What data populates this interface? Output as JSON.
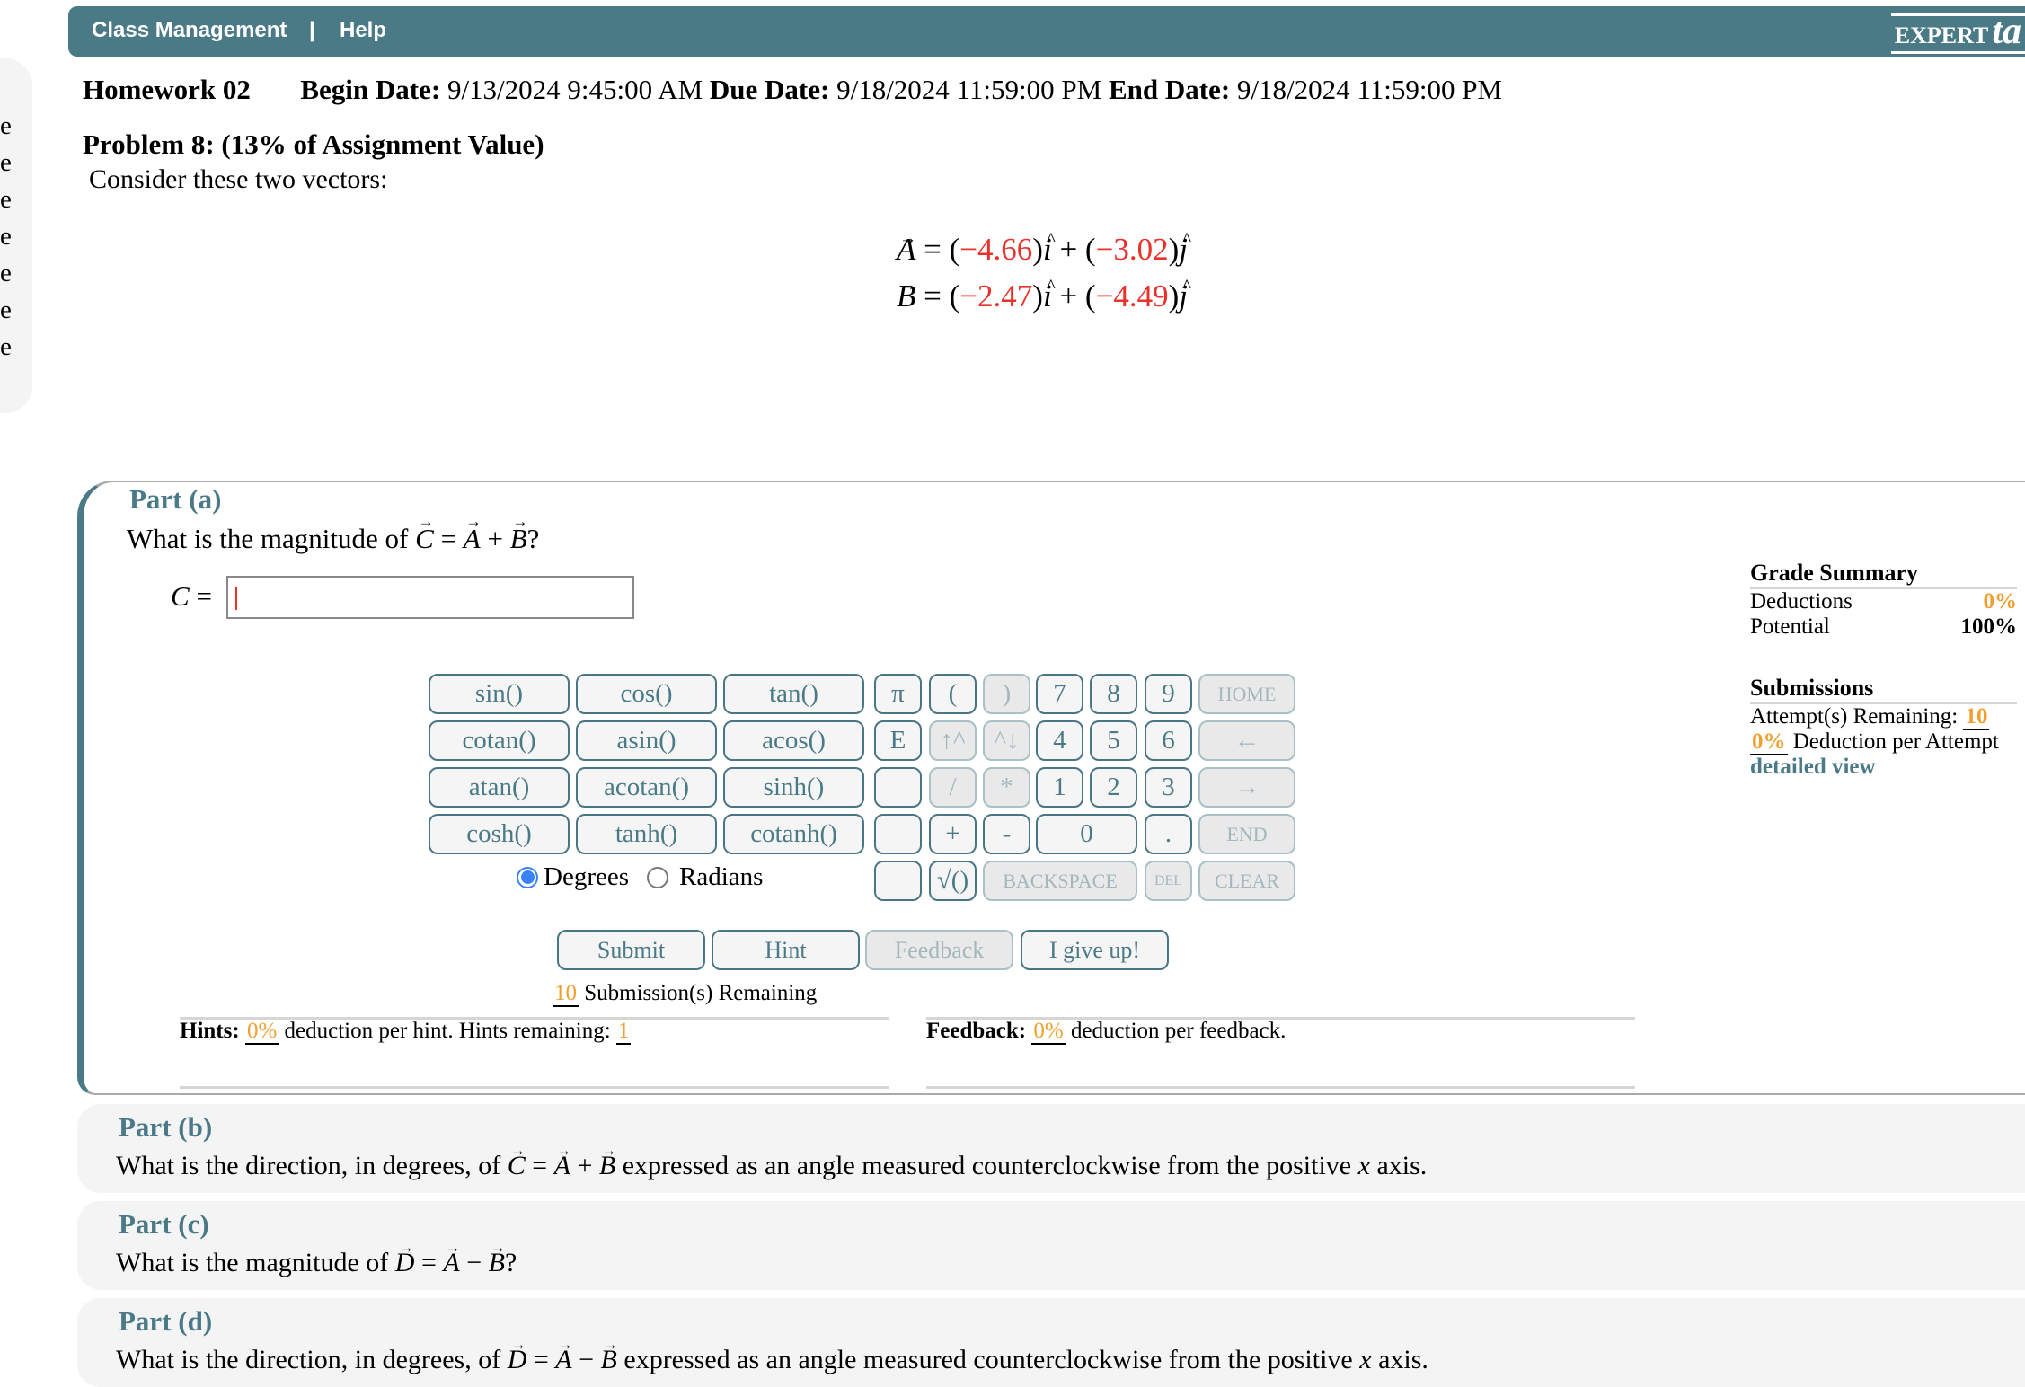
{
  "header": {
    "nav": [
      "Class Management",
      "|",
      "Help"
    ],
    "logo": "EXPERT",
    "logo_mark": "ta"
  },
  "sidebar": {
    "fragments": [
      "te",
      "te",
      "te",
      "te",
      "te",
      "te",
      "te"
    ]
  },
  "assignment": {
    "title": "Homework 02",
    "begin_label": "Begin Date:",
    "begin": "9/13/2024 9:45:00 AM",
    "due_label": "Due Date:",
    "due": "9/18/2024 11:59:00 PM",
    "end_label": "End Date:",
    "end": "9/18/2024 11:59:00 PM"
  },
  "problem": {
    "title": "Problem 8: (13% of Assignment Value)",
    "intro": "Consider these two vectors:",
    "vectors": [
      {
        "name": "A",
        "x": "−4.66",
        "y": "−3.02"
      },
      {
        "name": "B",
        "x": "−2.47",
        "y": "−4.49"
      }
    ],
    "unit_i": "i",
    "unit_j": "j"
  },
  "part_a": {
    "label": "Part (a)",
    "q_prefix": "What is the magnitude of ",
    "v0": "C",
    "eq": "=",
    "v1": "A",
    "op": "+",
    "v2": "B",
    "q_suffix": "?",
    "answer_label": "C",
    "answer_eq": "=",
    "answer_value": "",
    "keypad": {
      "functions": [
        "sin()",
        "cos()",
        "tan()",
        "cotan()",
        "asin()",
        "acos()",
        "atan()",
        "acotan()",
        "sinh()",
        "cosh()",
        "tanh()",
        "cotanh()"
      ],
      "keys": [
        [
          {
            "l": "π"
          },
          {
            "l": "("
          },
          {
            "l": ")",
            "d": true
          },
          {
            "l": "7"
          },
          {
            "l": "8"
          },
          {
            "l": "9"
          },
          {
            "l": "HOME",
            "d": true
          }
        ],
        [
          {
            "l": "E"
          },
          {
            "l": "↑^",
            "d": true
          },
          {
            "l": "^↓",
            "d": true
          },
          {
            "l": "4"
          },
          {
            "l": "5"
          },
          {
            "l": "6"
          },
          {
            "l": "←",
            "d": true
          }
        ],
        [
          {
            "l": ""
          },
          {
            "l": "/",
            "d": true
          },
          {
            "l": "*",
            "d": true
          },
          {
            "l": "1"
          },
          {
            "l": "2"
          },
          {
            "l": "3"
          },
          {
            "l": "→",
            "d": true
          }
        ],
        [
          {
            "l": ""
          },
          {
            "l": "+"
          },
          {
            "l": "-"
          },
          {
            "l": "0"
          },
          {
            "l": "."
          },
          {
            "l": "END",
            "d": true
          }
        ],
        [
          {
            "l": ""
          },
          {
            "l": "√()"
          },
          {
            "l": "BACKSPACE",
            "d": true
          },
          {
            "l": "DEL",
            "d": true
          },
          {
            "l": "CLEAR",
            "d": true
          }
        ]
      ],
      "angle_mode": {
        "degrees": "Degrees",
        "radians": "Radians",
        "selected": "Degrees"
      }
    },
    "buttons": {
      "submit": "Submit",
      "hint": "Hint",
      "feedback": "Feedback",
      "give_up": "I give up!"
    },
    "submissions_remaining": "10",
    "submissions_label": "Submission(s) Remaining",
    "hints": {
      "label": "Hints:",
      "deduction": "0%",
      "text": "deduction per hint. Hints remaining:",
      "remaining": "1"
    },
    "feedback": {
      "label": "Feedback:",
      "deduction": "0%",
      "text": "deduction per feedback."
    }
  },
  "grade_summary": {
    "title": "Grade Summary",
    "deductions_label": "Deductions",
    "deductions": "0%",
    "potential_label": "Potential",
    "potential": "100%",
    "submissions_title": "Submissions",
    "attempts_label": "Attempt(s) Remaining:",
    "attempts": "10",
    "per_attempt": "0%",
    "per_attempt_label": "Deduction per Attempt",
    "detailed_view": "detailed view"
  },
  "part_b": {
    "label": "Part (b)",
    "q_prefix": "What is the direction, in degrees, of ",
    "v0": "C",
    "eq": "=",
    "v1": "A",
    "op": "+",
    "v2": "B",
    "q_suffix": " expressed as an angle measured counterclockwise from the positive ",
    "axis": "x",
    "q_end": " axis."
  },
  "part_c": {
    "label": "Part (c)",
    "q_prefix": "What is the magnitude of ",
    "v0": "D",
    "eq": "=",
    "v1": "A",
    "op": "−",
    "v2": "B",
    "q_suffix": "?"
  },
  "part_d": {
    "label": "Part (d)",
    "q_prefix": "What is the direction, in degrees, of ",
    "v0": "D",
    "eq": "=",
    "v1": "A",
    "op": "−",
    "v2": "B",
    "q_suffix": " expressed as an angle measured counterclockwise from the positive ",
    "axis": "x",
    "q_end": " axis."
  },
  "colors": {
    "header": "#4b7a87",
    "accent": "#4a7a87",
    "highlight": "#f0a030",
    "given_value": "#e8322a"
  }
}
